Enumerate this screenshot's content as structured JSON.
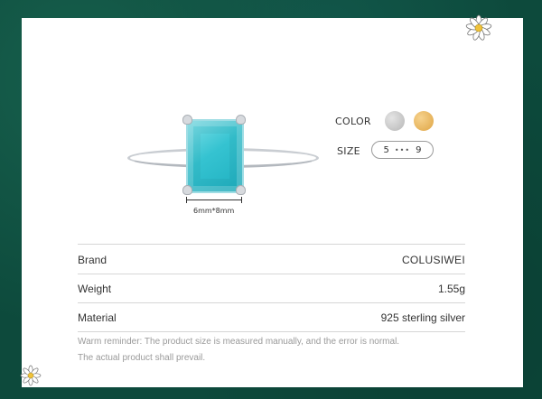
{
  "product_image": {
    "dimension_label": "6mm*8mm",
    "gem_color": "#35c3d1",
    "band_color": "#c9cdd2"
  },
  "options": {
    "color_label": "COLOR",
    "color_swatches": [
      {
        "name": "silver",
        "hex": "#c5c5c5"
      },
      {
        "name": "gold",
        "hex": "#e8b35c"
      }
    ],
    "size_label": "SIZE",
    "size_min": "5",
    "size_separator": "•••",
    "size_max": "9"
  },
  "specs": [
    {
      "label": "Brand",
      "value": "COLUSIWEI"
    },
    {
      "label": "Weight",
      "value": "1.55g"
    },
    {
      "label": "Material",
      "value": "925 sterling silver"
    }
  ],
  "reminder": {
    "line1": "Warm reminder: The product size is measured manually, and the error is normal.",
    "line2": "The actual product shall prevail."
  },
  "decorations": {
    "flower_icon": "daisy-icon",
    "background_color": "#0d4a3c"
  }
}
